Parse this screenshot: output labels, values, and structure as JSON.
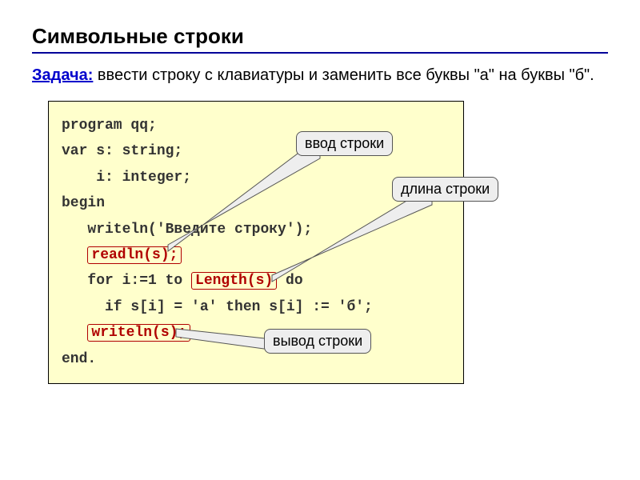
{
  "title": "Символьные строки",
  "task_label": "Задача:",
  "task_text": " ввести строку с клавиатуры и заменить все буквы \"а\" на буквы \"б\".",
  "code": {
    "l1": "program qq;",
    "l2": "var s: string;",
    "l3_indent": "    i: integer;",
    "l4": "begin",
    "l5_pre": "   writeln('Введите строку');",
    "l6_pre": "   ",
    "l6_hl": "readln(s);",
    "l7_pre": "   for i:=1 to ",
    "l7_hl": "Length(s)",
    "l7_post": " do",
    "l8": "     if s[i] = 'а' then s[i] := 'б';",
    "l9_pre": "   ",
    "l9_hl": "writeln(s);",
    "l10": "end."
  },
  "callouts": {
    "input": "ввод строки",
    "length": "длина строки",
    "output": "вывод строки"
  }
}
